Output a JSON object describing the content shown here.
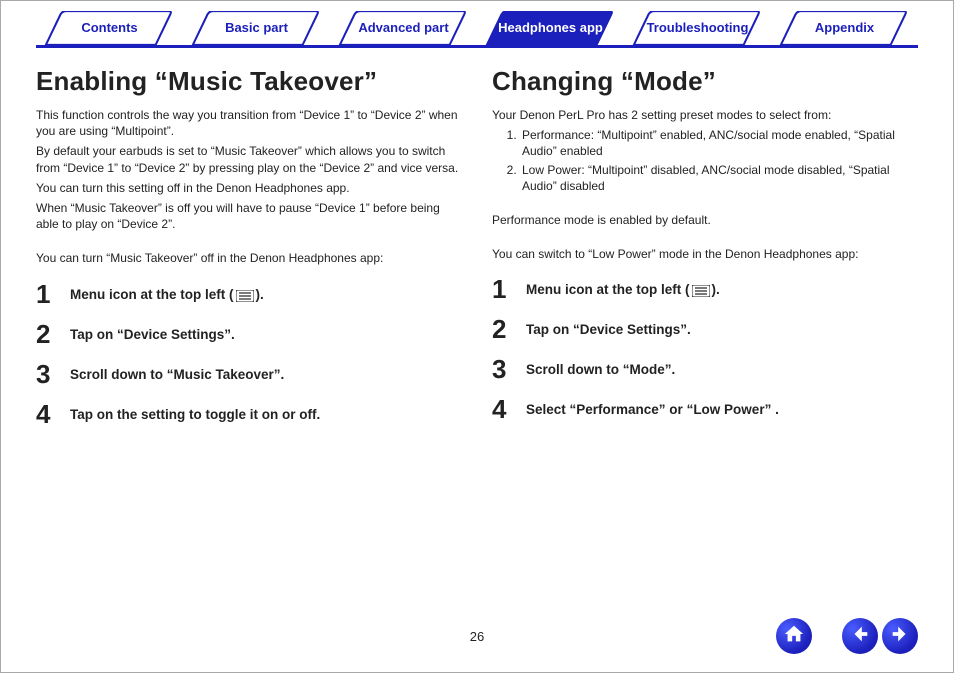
{
  "page_number": "26",
  "tabs": [
    {
      "id": "contents",
      "label": "Contents",
      "active": false
    },
    {
      "id": "basic",
      "label": "Basic part",
      "active": false
    },
    {
      "id": "advanced",
      "label": "Advanced part",
      "active": false
    },
    {
      "id": "app",
      "label": "Headphones app",
      "active": true
    },
    {
      "id": "trouble",
      "label": "Troubleshooting",
      "active": false
    },
    {
      "id": "appendix",
      "label": "Appendix",
      "active": false
    }
  ],
  "left": {
    "title": "Enabling “Music Takeover”",
    "p1": "This function controls the way you transition from “Device 1” to “Device 2” when you are using “Multipoint”.",
    "p2": "By default your earbuds is set to “Music Takeover” which allows you to switch from “Device 1” to “Device 2” by pressing play on the “Device 2” and vice versa.",
    "p3": "You can turn this setting off in the Denon Headphones app.",
    "p4": "When “Music Takeover” is off you will have to pause “Device 1” before being able to play on “Device 2”.",
    "p5": "You can turn “Music Takeover” off in the Denon Headphones app:",
    "step1_pre": "Menu icon at the top left (",
    "step1_post": ").",
    "step2": "Tap on “Device Settings”.",
    "step3": "Scroll down to “Music Takeover”.",
    "step4": "Tap on the setting to toggle it on or off."
  },
  "right": {
    "title": "Changing “Mode”",
    "p1": "Your Denon PerL Pro has 2 setting preset modes to select from:",
    "mode1": "Performance: “Multipoint” enabled, ANC/social mode enabled, “Spatial Audio” enabled",
    "mode2": "Low Power: “Multipoint” disabled, ANC/social mode disabled, “Spatial Audio” disabled",
    "p2": "Performance mode is enabled by default.",
    "p3": "You can switch to “Low Power” mode in the Denon Headphones app:",
    "step1_pre": "Menu icon at the top left (",
    "step1_post": ").",
    "step2": "Tap on “Device Settings”.",
    "step3": "Scroll down to “Mode”.",
    "step4": "Select “Performance” or “Low Power” ."
  }
}
